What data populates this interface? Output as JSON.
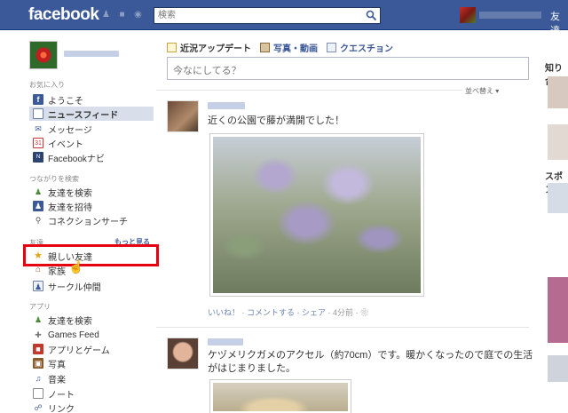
{
  "topbar": {
    "logo": "facebook",
    "search_placeholder": "検索",
    "right_link": "友達"
  },
  "left": {
    "favorites_title": "お気に入り",
    "favorites": [
      {
        "label": "ようこそ",
        "icon": "facebook-f-icon"
      },
      {
        "label": "ニュースフィード",
        "icon": "news-feed-icon"
      },
      {
        "label": "メッセージ",
        "icon": "messages-icon"
      },
      {
        "label": "イベント",
        "icon": "calendar-icon"
      },
      {
        "label": "Facebookナビ",
        "icon": "navi-icon"
      }
    ],
    "connect_title": "つながりを検索",
    "connect": [
      {
        "label": "友達を検索",
        "icon": "friends-icon"
      },
      {
        "label": "友達を招待",
        "icon": "invite-icon"
      },
      {
        "label": "コネクションサーチ",
        "icon": "search-icon"
      }
    ],
    "friends_title": "友達",
    "friends_more": "もっと見る",
    "friends": [
      {
        "label": "親しい友達",
        "icon": "star-icon"
      },
      {
        "label": "家族",
        "icon": "home-icon"
      },
      {
        "label": "サークル仲間",
        "icon": "group-icon"
      }
    ],
    "apps_title": "アプリ",
    "apps": [
      {
        "label": "友達を検索",
        "icon": "friends-icon"
      },
      {
        "label": "Games Feed",
        "icon": "puzzle-icon"
      },
      {
        "label": "アプリとゲーム",
        "icon": "apps-icon"
      },
      {
        "label": "写真",
        "icon": "photos-icon"
      },
      {
        "label": "音楽",
        "icon": "music-icon"
      },
      {
        "label": "ノート",
        "icon": "notes-icon"
      },
      {
        "label": "リンク",
        "icon": "link-icon"
      }
    ]
  },
  "composer": {
    "tabs": [
      "近況アップデート",
      "写真・動画",
      "クエスチョン"
    ],
    "placeholder": "今なにしてる？"
  },
  "feed": {
    "sort_label": "並べ替え ▾",
    "posts": [
      {
        "text": "近くの公園で藤が満開でした！",
        "actions": [
          "いいね！",
          "コメントする",
          "シェア"
        ],
        "time": "4分前"
      },
      {
        "text": "ケヅメリクガメのアクセル（約70cm）です。暖かくなったので庭での生活がはじまりました。"
      }
    ]
  },
  "right": {
    "titles": [
      "知り合",
      "スポン"
    ]
  },
  "colors": {
    "brand": "#3b5998",
    "highlight": "#e60012"
  }
}
